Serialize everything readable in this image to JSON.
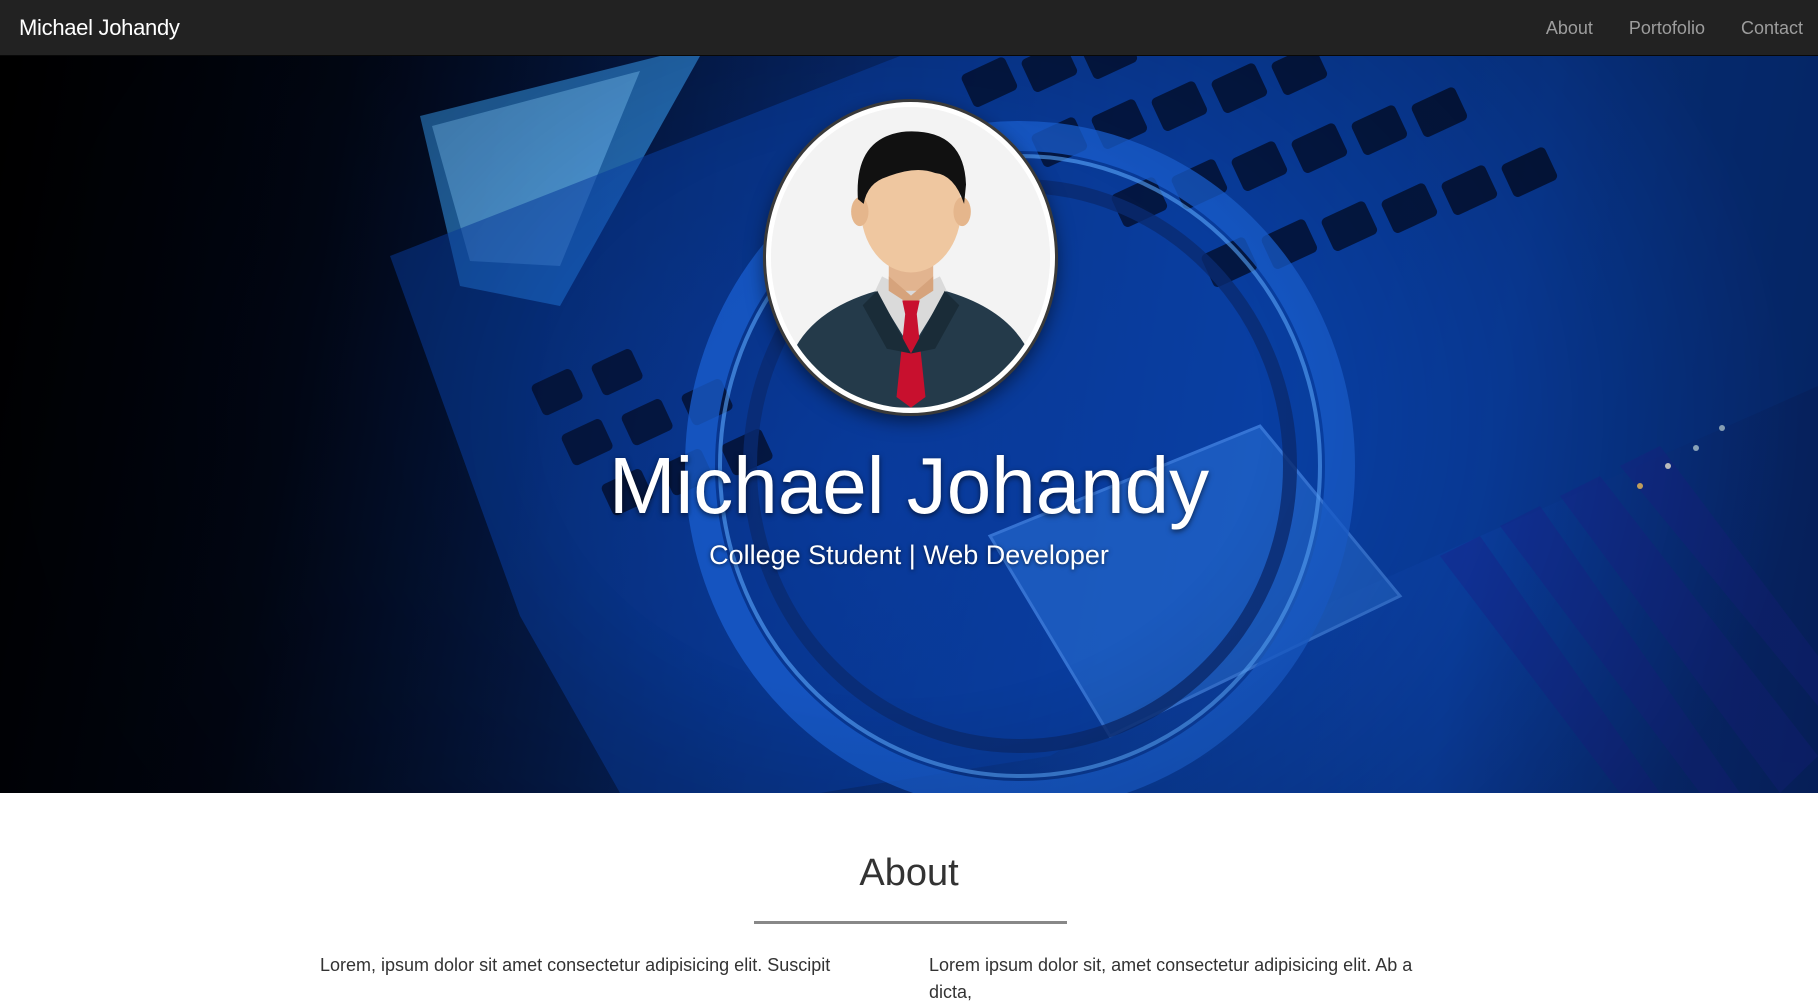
{
  "navbar": {
    "brand": "Michael Johandy",
    "links": [
      {
        "label": "About"
      },
      {
        "label": "Portofolio"
      },
      {
        "label": "Contact"
      }
    ]
  },
  "hero": {
    "name": "Michael Johandy",
    "tagline": "College Student | Web Developer",
    "avatar_icon": "person-avatar-icon"
  },
  "about": {
    "title": "About",
    "left_text": "Lorem, ipsum dolor sit amet consectetur adipisicing elit. Suscipit",
    "right_text": "Lorem ipsum dolor sit, amet consectetur adipisicing elit. Ab a dicta,"
  },
  "colors": {
    "navbar_bg": "#222222",
    "nav_link": "#9d9d9d",
    "hero_accent": "#0c47b6",
    "tie": "#c8102e"
  }
}
